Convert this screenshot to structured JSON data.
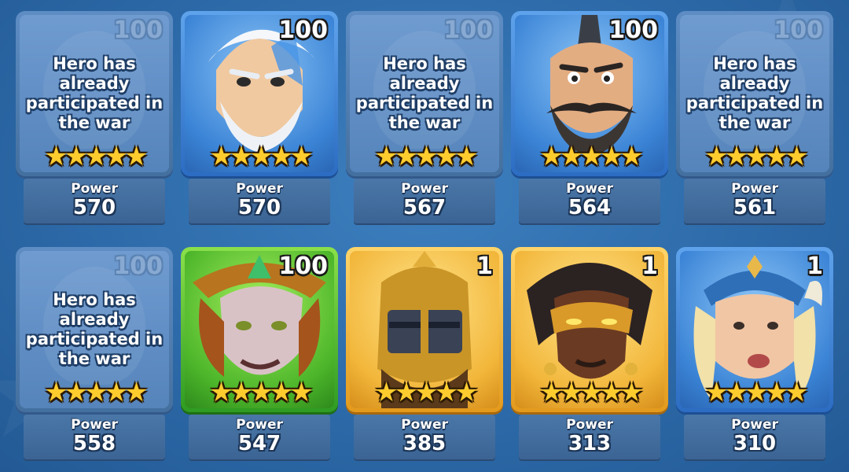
{
  "heroes": [
    {
      "level": "100",
      "status": "Hero has already participated in the war",
      "stars": "★★★★★",
      "power_label": "Power",
      "power": "570",
      "frame": "used",
      "hero_icon": "used-hero-icon"
    },
    {
      "level": "100",
      "status": "",
      "stars": "★★★★★",
      "power_label": "Power",
      "power": "570",
      "frame": "blue",
      "hero_icon": "wizard-hero-icon"
    },
    {
      "level": "100",
      "status": "Hero has already participated in the war",
      "stars": "★★★★★",
      "power_label": "Power",
      "power": "567",
      "frame": "used",
      "hero_icon": "used-hero-icon"
    },
    {
      "level": "100",
      "status": "",
      "stars": "★★★★★",
      "power_label": "Power",
      "power": "564",
      "frame": "blue",
      "hero_icon": "mohawk-warrior-hero-icon"
    },
    {
      "level": "100",
      "status": "Hero has already participated in the war",
      "stars": "★★★★★",
      "power_label": "Power",
      "power": "561",
      "frame": "used",
      "hero_icon": "used-hero-icon"
    },
    {
      "level": "100",
      "status": "Hero has already participated in the war",
      "stars": "★★★★★",
      "power_label": "Power",
      "power": "558",
      "frame": "used",
      "hero_icon": "used-hero-icon"
    },
    {
      "level": "100",
      "status": "",
      "stars": "★★★★★",
      "power_label": "Power",
      "power": "547",
      "frame": "green",
      "hero_icon": "forest-hero-icon"
    },
    {
      "level": "1",
      "status": "",
      "stars": "★★★★★",
      "power_label": "Power",
      "power": "385",
      "frame": "gold",
      "hero_icon": "knight-hero-icon"
    },
    {
      "level": "1",
      "status": "",
      "stars": "★★★★★",
      "power_label": "Power",
      "power": "313",
      "frame": "gold",
      "hero_icon": "masked-hero-icon"
    },
    {
      "level": "1",
      "status": "",
      "stars": "★★★★★",
      "power_label": "Power",
      "power": "310",
      "frame": "blue",
      "hero_icon": "viking-hero-icon"
    }
  ]
}
